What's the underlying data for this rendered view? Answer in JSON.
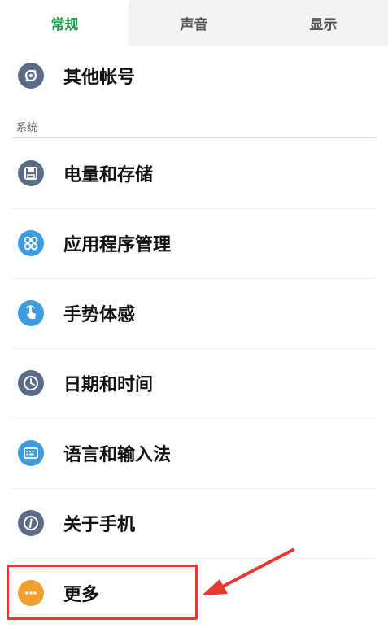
{
  "tabs": [
    {
      "label": "常规",
      "active": true
    },
    {
      "label": "声音",
      "active": false
    },
    {
      "label": "显示",
      "active": false
    }
  ],
  "accounts": {
    "label": "其他帐号",
    "icon": "sync-icon",
    "color": "#5b6b86"
  },
  "system_section": {
    "label": "系统"
  },
  "items": [
    {
      "label": "电量和存储",
      "icon": "floppy-disk-icon",
      "color": "#5b6b86"
    },
    {
      "label": "应用程序管理",
      "icon": "apps-grid-icon",
      "color": "#3d9be0"
    },
    {
      "label": "手势体感",
      "icon": "gesture-hand-icon",
      "color": "#3d9be0"
    },
    {
      "label": "日期和时间",
      "icon": "clock-icon",
      "color": "#5b6b86"
    },
    {
      "label": "语言和输入法",
      "icon": "keyboard-icon",
      "color": "#3d9be0"
    },
    {
      "label": "关于手机",
      "icon": "info-icon",
      "color": "#5b6b86"
    },
    {
      "label": "更多",
      "icon": "more-dots-icon",
      "color": "#f0a030"
    }
  ],
  "annotation": {
    "highlight_color": "#e53935"
  }
}
